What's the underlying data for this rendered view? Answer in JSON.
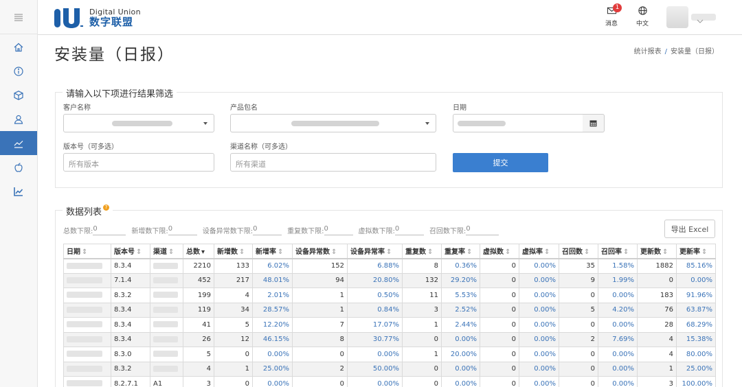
{
  "brand": {
    "name_en": "Digital Union",
    "name_cn": "数字联盟",
    "colors": {
      "primary": "#1d5fa8",
      "accent": "#3a7fd0",
      "badge": "#e13c3c"
    }
  },
  "topbar": {
    "messages_label": "消息",
    "messages_badge": "1",
    "language_label": "中文"
  },
  "sidebar": {
    "items": [
      {
        "icon": "home-icon"
      },
      {
        "icon": "info-icon"
      },
      {
        "icon": "cube-icon"
      },
      {
        "icon": "user-icon"
      },
      {
        "icon": "trend-icon",
        "active": true
      },
      {
        "icon": "apple-icon"
      },
      {
        "icon": "line-chart-icon"
      }
    ]
  },
  "page": {
    "title": "安装量（日报）",
    "breadcrumb_parent": "统计报表",
    "breadcrumb_sep": "/",
    "breadcrumb_current": "安装量（日报）"
  },
  "filter": {
    "legend": "请输入以下项进行结果筛选",
    "customer_label": "客户名称",
    "package_label": "产品包名",
    "date_label": "日期",
    "version_label": "版本号（可多选）",
    "version_placeholder": "所有版本",
    "channel_label": "渠道名称（可多选）",
    "channel_placeholder": "所有渠道",
    "submit_label": "提交"
  },
  "data_panel": {
    "legend": "数据列表",
    "help_glyph": "?",
    "export_label": "导出 Excel",
    "thresholds": [
      {
        "label": "总数下限:",
        "value": "0"
      },
      {
        "label": "新增数下限:",
        "value": "0"
      },
      {
        "label": "设备异常数下限:",
        "value": "0"
      },
      {
        "label": "重复数下限:",
        "value": "0"
      },
      {
        "label": "虚拟数下限:",
        "value": "0"
      },
      {
        "label": "召回数下限:",
        "value": "0"
      }
    ],
    "sort_glyph": "⇕",
    "sorted_glyph": "▾",
    "columns": [
      "日期",
      "版本号",
      "渠道",
      "总数",
      "新增数",
      "新增率",
      "设备异常数",
      "设备异常率",
      "重复数",
      "重复率",
      "虚拟数",
      "虚拟率",
      "召回数",
      "召回率",
      "更新数",
      "更新率"
    ],
    "rows": [
      {
        "date": "",
        "version": "8.3.4",
        "channel": "",
        "total": "2210",
        "new": "133",
        "new_rate": "6.02%",
        "abn": "152",
        "abn_rate": "6.88%",
        "dup": "8",
        "dup_rate": "0.36%",
        "virt": "0",
        "virt_rate": "0.00%",
        "recall": "35",
        "recall_rate": "1.58%",
        "upd": "1882",
        "upd_rate": "85.16%"
      },
      {
        "date": "",
        "version": "7.1.4",
        "channel": "",
        "total": "452",
        "new": "217",
        "new_rate": "48.01%",
        "abn": "94",
        "abn_rate": "20.80%",
        "dup": "132",
        "dup_rate": "29.20%",
        "virt": "0",
        "virt_rate": "0.00%",
        "recall": "9",
        "recall_rate": "1.99%",
        "upd": "0",
        "upd_rate": "0.00%"
      },
      {
        "date": "",
        "version": "8.3.2",
        "channel": "",
        "total": "199",
        "new": "4",
        "new_rate": "2.01%",
        "abn": "1",
        "abn_rate": "0.50%",
        "dup": "11",
        "dup_rate": "5.53%",
        "virt": "0",
        "virt_rate": "0.00%",
        "recall": "0",
        "recall_rate": "0.00%",
        "upd": "183",
        "upd_rate": "91.96%"
      },
      {
        "date": "",
        "version": "8.3.4",
        "channel": "",
        "total": "119",
        "new": "34",
        "new_rate": "28.57%",
        "abn": "1",
        "abn_rate": "0.84%",
        "dup": "3",
        "dup_rate": "2.52%",
        "virt": "0",
        "virt_rate": "0.00%",
        "recall": "5",
        "recall_rate": "4.20%",
        "upd": "76",
        "upd_rate": "63.87%"
      },
      {
        "date": "",
        "version": "8.3.4",
        "channel": "",
        "total": "41",
        "new": "5",
        "new_rate": "12.20%",
        "abn": "7",
        "abn_rate": "17.07%",
        "dup": "1",
        "dup_rate": "2.44%",
        "virt": "0",
        "virt_rate": "0.00%",
        "recall": "0",
        "recall_rate": "0.00%",
        "upd": "28",
        "upd_rate": "68.29%"
      },
      {
        "date": "",
        "version": "8.3.4",
        "channel": "",
        "total": "26",
        "new": "12",
        "new_rate": "46.15%",
        "abn": "8",
        "abn_rate": "30.77%",
        "dup": "0",
        "dup_rate": "0.00%",
        "virt": "0",
        "virt_rate": "0.00%",
        "recall": "2",
        "recall_rate": "7.69%",
        "upd": "4",
        "upd_rate": "15.38%"
      },
      {
        "date": "",
        "version": "8.3.0",
        "channel": "",
        "total": "5",
        "new": "0",
        "new_rate": "0.00%",
        "abn": "0",
        "abn_rate": "0.00%",
        "dup": "1",
        "dup_rate": "20.00%",
        "virt": "0",
        "virt_rate": "0.00%",
        "recall": "0",
        "recall_rate": "0.00%",
        "upd": "4",
        "upd_rate": "80.00%"
      },
      {
        "date": "",
        "version": "8.3.2",
        "channel": "",
        "total": "4",
        "new": "1",
        "new_rate": "25.00%",
        "abn": "2",
        "abn_rate": "50.00%",
        "dup": "0",
        "dup_rate": "0.00%",
        "virt": "0",
        "virt_rate": "0.00%",
        "recall": "0",
        "recall_rate": "0.00%",
        "upd": "1",
        "upd_rate": "25.00%"
      },
      {
        "date": "",
        "version": "8.2.7.1",
        "channel": "A1",
        "total": "3",
        "new": "0",
        "new_rate": "0.00%",
        "abn": "0",
        "abn_rate": "0.00%",
        "dup": "0",
        "dup_rate": "0.00%",
        "virt": "0",
        "virt_rate": "0.00%",
        "recall": "0",
        "recall_rate": "0.00%",
        "upd": "3",
        "upd_rate": "100.00%"
      }
    ]
  }
}
